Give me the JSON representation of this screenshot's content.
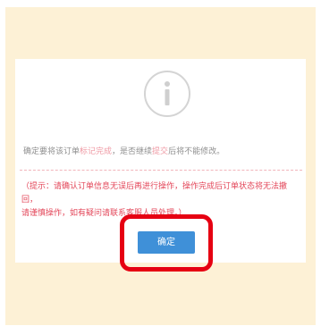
{
  "dialog": {
    "icon": "info-icon",
    "message": {
      "prefix": "确定要将该订单",
      "highlight1": "标记完成",
      "middle": "，是否继续",
      "highlight2": "提交",
      "suffix": "后将不能修改。"
    },
    "notice": [
      "（提示：请确认订单信息无误后再进行操作，操作完成后订单状态将无法撤回，",
      "请谨慎操作，如有疑问请联系客服人员处理。）"
    ],
    "confirm_button": "确定"
  },
  "colors": {
    "background": "#fdf1d6",
    "accent": "#3f90d8",
    "notice": "#e3475a",
    "highlight_border": "#e60012"
  }
}
